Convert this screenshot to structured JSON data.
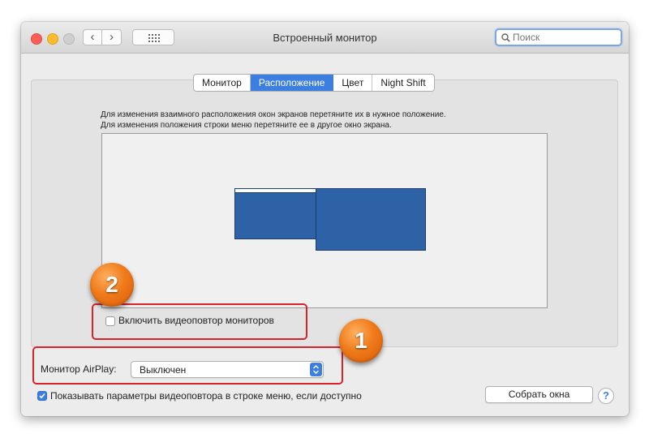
{
  "window": {
    "title": "Встроенный монитор",
    "search": {
      "placeholder": "Поиск"
    }
  },
  "tabs": [
    {
      "label": "Монитор",
      "active": false
    },
    {
      "label": "Расположение",
      "active": true
    },
    {
      "label": "Цвет",
      "active": false
    },
    {
      "label": "Night Shift",
      "active": false
    }
  ],
  "arrangement": {
    "instruction_line1": "Для изменения взаимного расположения окон экранов перетяните их в нужное положение.",
    "instruction_line2": "Для изменения положения строки меню перетяните ее в другое окно экрана."
  },
  "mirror_displays": {
    "label": "Включить видеоповтор мониторов",
    "checked": false
  },
  "airplay": {
    "label": "Монитор AirPlay:",
    "value": "Выключен"
  },
  "menu_option": {
    "label": "Показывать параметры видеоповтора в строке меню, если доступно",
    "checked": true
  },
  "buttons": {
    "gather_windows": "Собрать окна",
    "help": "?"
  },
  "annotations": {
    "marker_1": "1",
    "marker_2": "2"
  },
  "colors": {
    "accent": "#3d7fe0",
    "display": "#2d62a6",
    "highlight": "#d9232a",
    "marker": "#f07b1a"
  },
  "icons": [
    "close-icon",
    "minimize-icon",
    "zoom-icon",
    "chevron-left-icon",
    "chevron-right-icon",
    "grid-icon",
    "search-icon",
    "checkmark-icon",
    "updown-arrows-icon",
    "help-icon"
  ]
}
